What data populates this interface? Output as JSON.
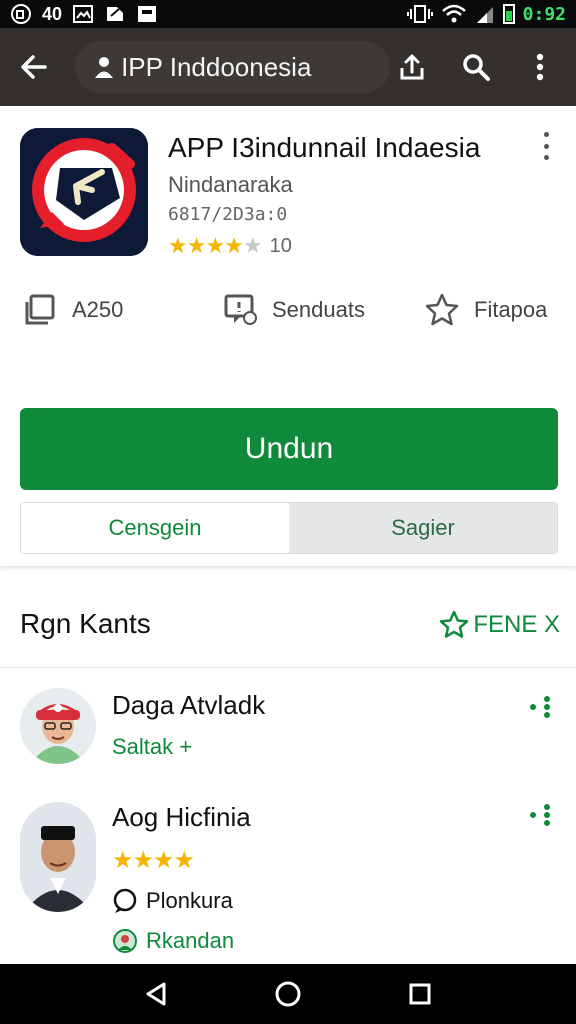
{
  "status_bar": {
    "left_text": "40",
    "time": "0:92",
    "icons": [
      "sim-icon",
      "photo-icon",
      "edit-icon",
      "message-icon",
      "vibrate-icon",
      "wifi-icon",
      "signal-icon",
      "battery-icon"
    ]
  },
  "app_bar": {
    "title": "IPP Inddoonesia",
    "icons": [
      "back-arrow-icon",
      "person-icon",
      "share-icon",
      "search-icon",
      "overflow-menu-icon"
    ]
  },
  "app": {
    "name": "APP I3indunnail Indaesia",
    "developer": "Nindanaraka",
    "meta": "6817/2D3a:0",
    "rating_value": 4,
    "rating_max": 5,
    "rating_count": "10"
  },
  "stats": [
    {
      "icon": "copy-icon",
      "label": "A250"
    },
    {
      "icon": "chat-icon",
      "label": "Senduats"
    },
    {
      "icon": "star-outline-icon",
      "label": "Fitapoa"
    }
  ],
  "actions": {
    "install": "Undun",
    "segment_left": "Censgein",
    "segment_right": "Sagier"
  },
  "reviews_section": {
    "title": "Rgn Kants",
    "link_label": "FENE X"
  },
  "reviews": [
    {
      "name": "Daga Atvladk",
      "subtitle": "Saltak +"
    },
    {
      "name": "Aog Hicfinia",
      "rating_value": 4,
      "line1": "Plonkura",
      "line2": "Rkandan"
    }
  ],
  "colors": {
    "accent_green": "#0f8a3a",
    "app_bar": "#33302d",
    "star": "#f4b400"
  }
}
